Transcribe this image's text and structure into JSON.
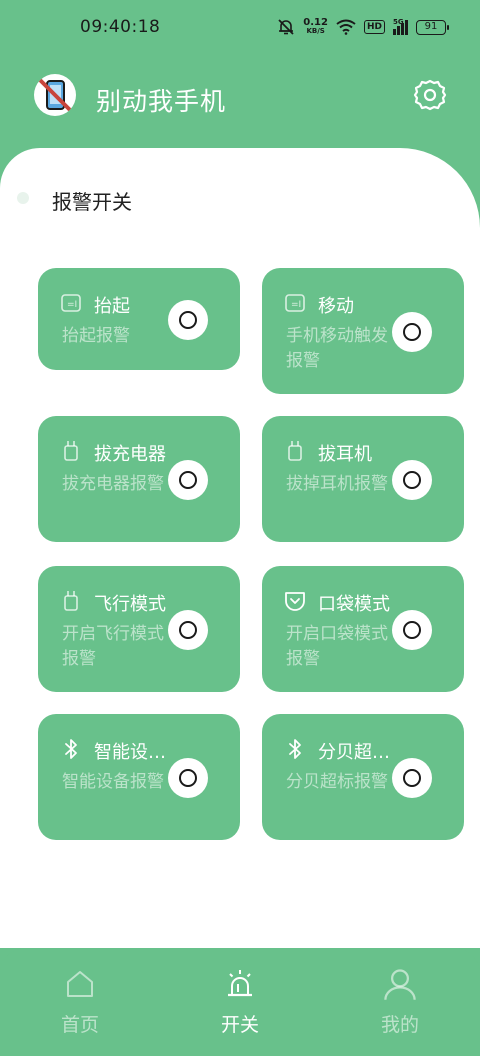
{
  "status_bar": {
    "time": "09:40:18",
    "net_speed": "0.12",
    "net_unit": "KB/S",
    "hd": "HD",
    "signal_gen": "5G",
    "battery": "91"
  },
  "header": {
    "title": "别动我手机",
    "logo_icon": "phone-crossed-icon",
    "settings_icon": "gear-icon"
  },
  "section": {
    "title": "报警开关"
  },
  "cards": [
    {
      "title": "抬起",
      "desc": "抬起报警",
      "icon": "phone-lift-icon",
      "on": false
    },
    {
      "title": "移动",
      "desc": "手机移动触发报警",
      "icon": "phone-move-icon",
      "on": false
    },
    {
      "title": "拔充电器",
      "desc": "拔充电器报警",
      "icon": "charger-plug-icon",
      "on": false
    },
    {
      "title": "拔耳机",
      "desc": "拔掉耳机报警",
      "icon": "earphone-plug-icon",
      "on": false
    },
    {
      "title": "飞行模式",
      "desc": "开启飞行模式报警",
      "icon": "plug-icon",
      "on": false
    },
    {
      "title": "口袋模式",
      "desc": "开启口袋模式报警",
      "icon": "pocket-icon",
      "on": false
    },
    {
      "title": "智能设…",
      "desc": "智能设备报警",
      "icon": "bluetooth-icon",
      "on": false
    },
    {
      "title": "分贝超…",
      "desc": "分贝超标报警",
      "icon": "bluetooth-icon",
      "on": false
    }
  ],
  "nav": [
    {
      "label": "首页",
      "icon": "home-icon",
      "active": false
    },
    {
      "label": "开关",
      "icon": "alarm-light-icon",
      "active": true
    },
    {
      "label": "我的",
      "icon": "user-icon",
      "active": false
    }
  ],
  "colors": {
    "primary": "#68c18b",
    "card_text_muted": "rgba(255,255,255,0.55)"
  }
}
